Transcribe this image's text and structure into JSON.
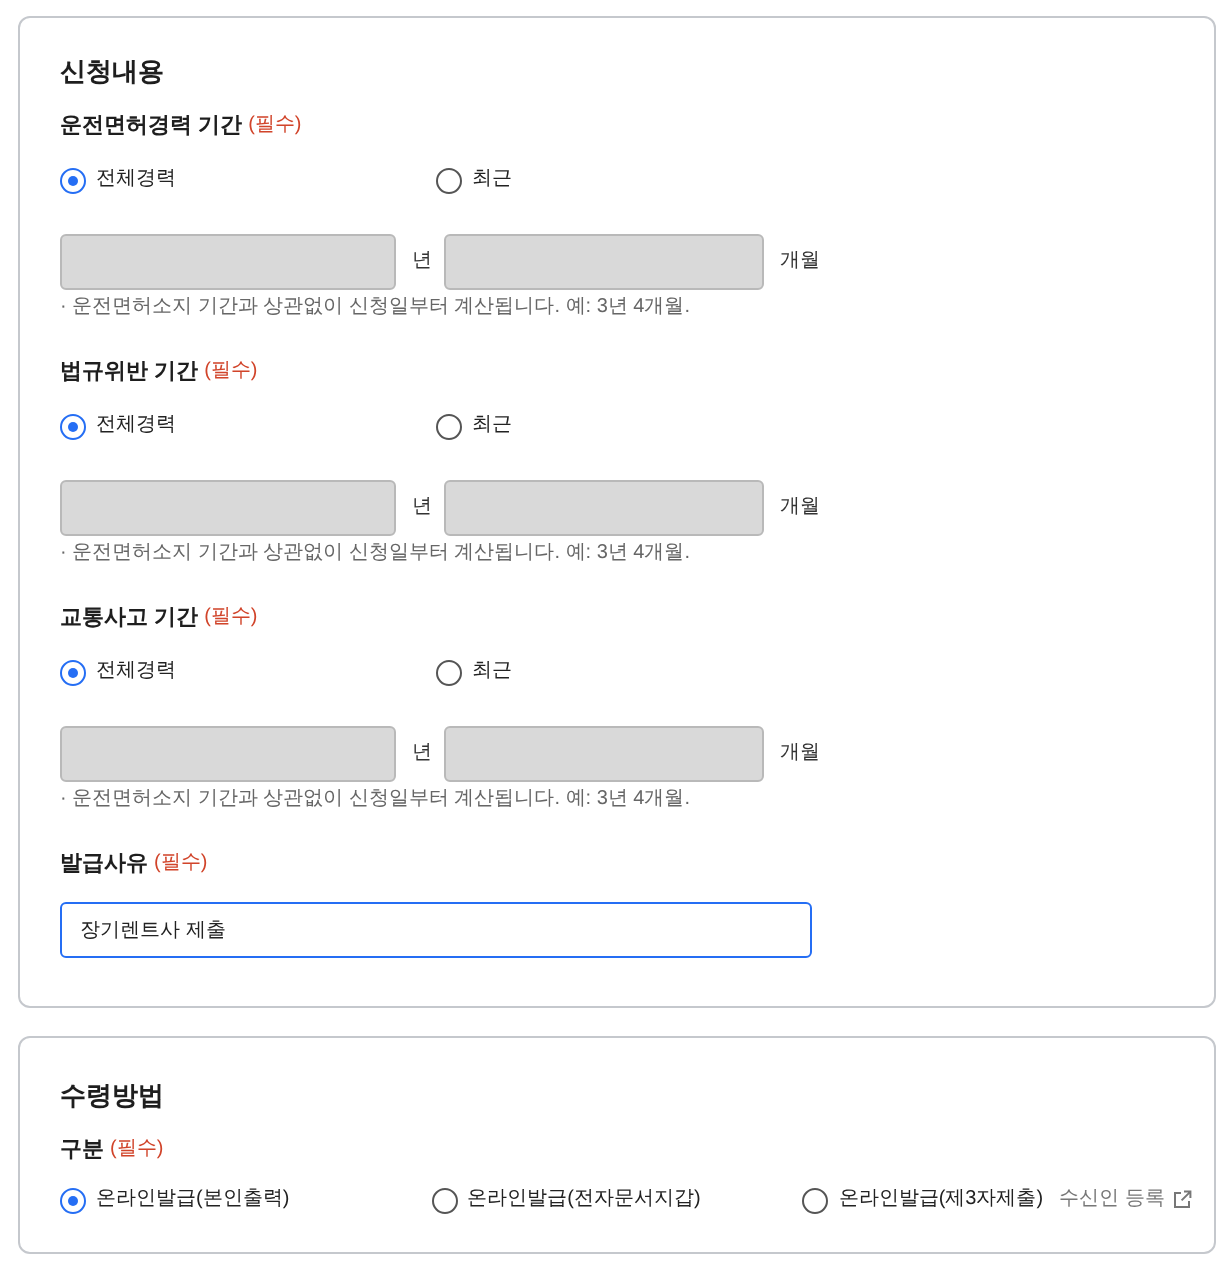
{
  "sections": [
    {
      "title": "신청내용",
      "fields": [
        {
          "kind": "period",
          "label": "운전면허경력 기간",
          "required": "(필수)",
          "options": [
            {
              "label": "전체경력",
              "selected": true
            },
            {
              "label": "최근",
              "selected": false
            }
          ],
          "inputs": [
            {
              "unit": "년",
              "disabled": true
            },
            {
              "unit": "개월",
              "disabled": true
            }
          ],
          "note": "· 운전면허소지 기간과 상관없이 신청일부터 계산됩니다. 예: 3년 4개월."
        },
        {
          "kind": "period",
          "label": "법규위반 기간",
          "required": "(필수)",
          "options": [
            {
              "label": "전체경력",
              "selected": true
            },
            {
              "label": "최근",
              "selected": false
            }
          ],
          "inputs": [
            {
              "unit": "년",
              "disabled": true
            },
            {
              "unit": "개월",
              "disabled": true
            }
          ],
          "note": "· 운전면허소지 기간과 상관없이 신청일부터 계산됩니다. 예: 3년 4개월."
        },
        {
          "kind": "period",
          "label": "교통사고 기간",
          "required": "(필수)",
          "options": [
            {
              "label": "전체경력",
              "selected": true
            },
            {
              "label": "최근",
              "selected": false
            }
          ],
          "inputs": [
            {
              "unit": "년",
              "disabled": true
            },
            {
              "unit": "개월",
              "disabled": true
            }
          ],
          "note": "· 운전면허소지 기간과 상관없이 신청일부터 계산됩니다. 예: 3년 4개월."
        },
        {
          "kind": "text",
          "label": "발급사유",
          "required": "(필수)",
          "value": "장기렌트사 제출",
          "focused": true
        }
      ]
    },
    {
      "title": "수령방법",
      "fields": [
        {
          "kind": "choice",
          "label": "구분",
          "required": "(필수)",
          "options": [
            {
              "label": "온라인발급(본인출력)",
              "selected": true
            },
            {
              "label": "온라인발급(전자문서지갑)",
              "selected": false
            },
            {
              "label": "온라인발급(제3자제출)",
              "selected": false,
              "link": "수신인 등록"
            }
          ]
        }
      ]
    }
  ]
}
